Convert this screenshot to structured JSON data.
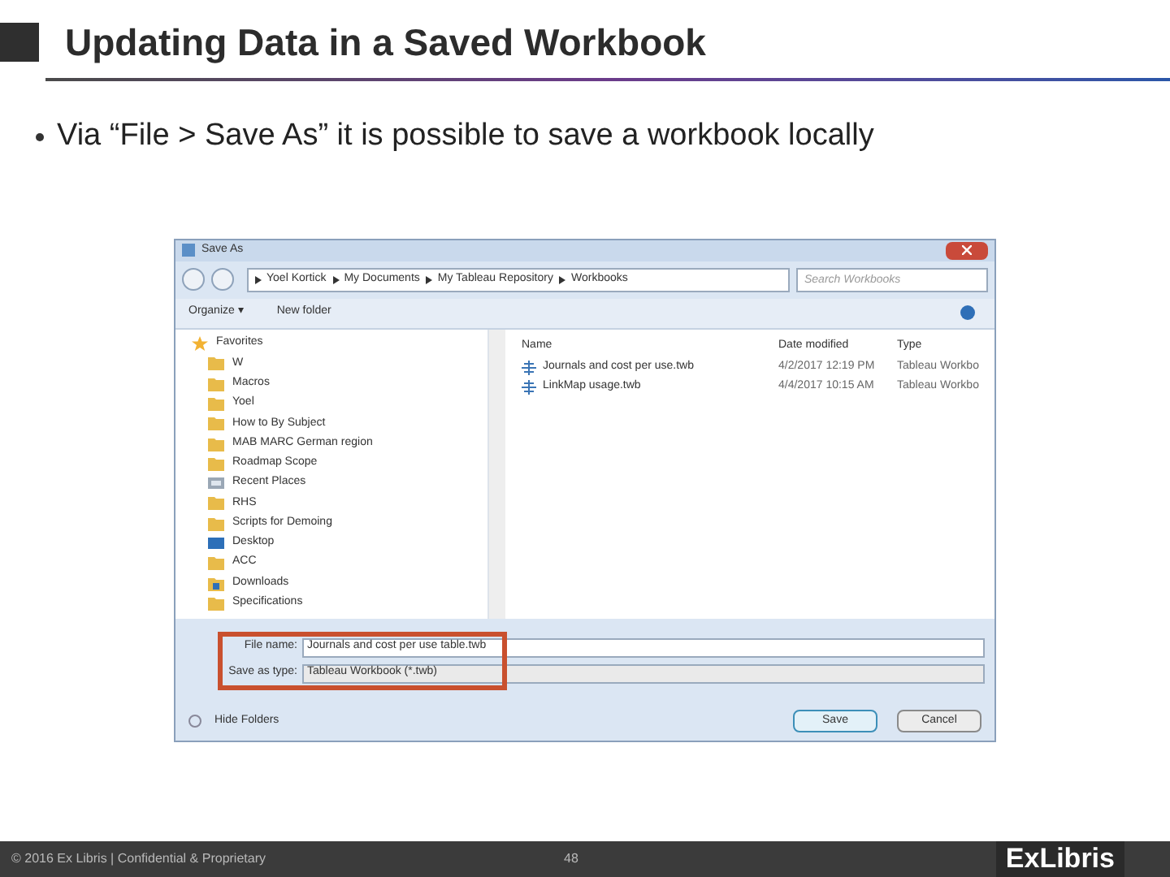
{
  "slide": {
    "title": "Updating Data in a Saved Workbook",
    "bullets": [
      "Via “File > Save As” it is possible to save a workbook locally"
    ]
  },
  "dialog": {
    "title": "Save As",
    "breadcrumb": [
      "Yoel Kortick",
      "My Documents",
      "My Tableau Repository",
      "Workbooks"
    ],
    "search": {
      "placeholder": "Search Workbooks"
    },
    "toolbar": [
      "Organize ▾",
      "New folder"
    ],
    "nav_items": [
      {
        "label": "Favorites",
        "kind": "star"
      },
      {
        "label": "W",
        "kind": "folder"
      },
      {
        "label": "Macros",
        "kind": "folder"
      },
      {
        "label": "Yoel",
        "kind": "folder"
      },
      {
        "label": "How to By Subject",
        "kind": "folder"
      },
      {
        "label": "MAB MARC German region",
        "kind": "folder"
      },
      {
        "label": "Roadmap Scope",
        "kind": "folder"
      },
      {
        "label": "Recent Places",
        "kind": "recent"
      },
      {
        "label": "RHS",
        "kind": "folder"
      },
      {
        "label": "Scripts for Demoing",
        "kind": "folder"
      },
      {
        "label": "Desktop",
        "kind": "desktop"
      },
      {
        "label": "ACC",
        "kind": "folder"
      },
      {
        "label": "Downloads",
        "kind": "download"
      },
      {
        "label": "Specifications",
        "kind": "folder"
      }
    ],
    "columns": [
      "Name",
      "Date modified",
      "Type"
    ],
    "files": [
      {
        "name": "Journals and cost per use.twb",
        "date": "4/2/2017 12:19 PM",
        "type": "Tableau Workbo"
      },
      {
        "name": "LinkMap usage.twb",
        "date": "4/4/2017 10:15 AM",
        "type": "Tableau Workbo"
      }
    ],
    "file_name": {
      "label": "File name:",
      "value": "Journals and cost per use table.twb"
    },
    "save_type": {
      "label": "Save as type:",
      "value": "Tableau Workbook (*.twb)"
    },
    "hide_folders": "Hide Folders",
    "buttons": [
      "Save",
      "Cancel"
    ]
  },
  "footer": {
    "copyright": "© 2016 Ex Libris | Confidential & Proprietary",
    "page": "48",
    "logo": "ExLibris"
  }
}
